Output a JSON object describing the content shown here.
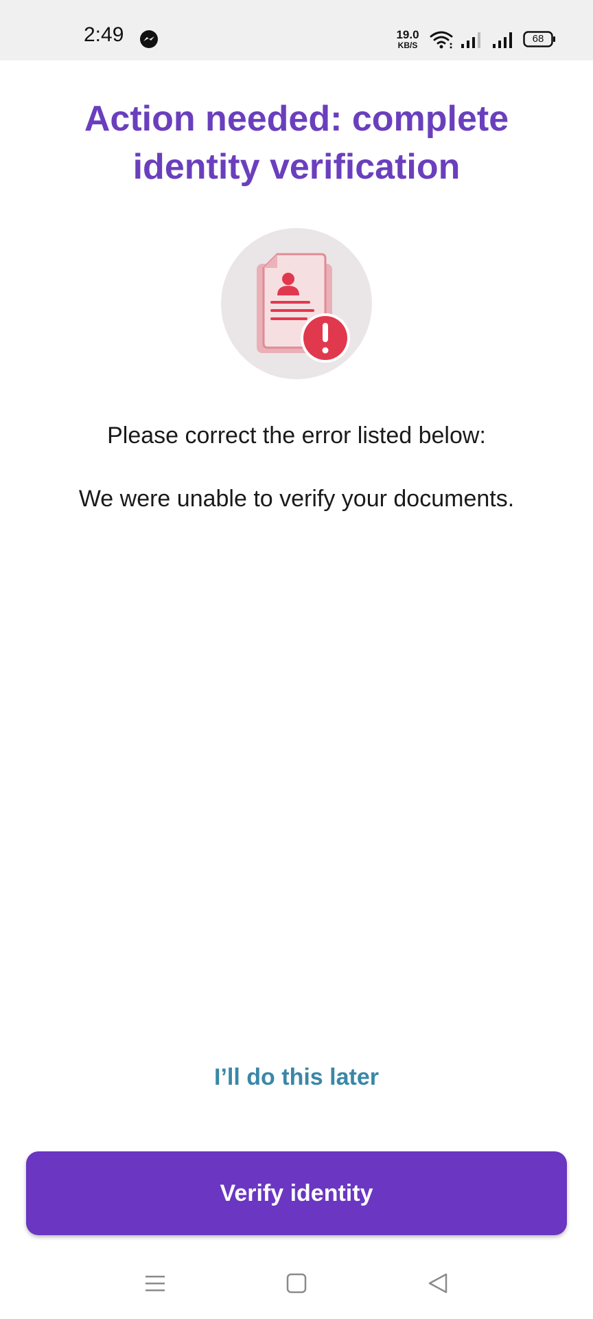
{
  "status_bar": {
    "time": "2:49",
    "net_speed_value": "19.0",
    "net_speed_unit": "KB/S",
    "battery_level": "68",
    "icons": [
      "messenger-icon",
      "wifi-icon",
      "signal-icon",
      "signal-icon",
      "battery-icon"
    ]
  },
  "main": {
    "title": "Action needed: complete identity verification",
    "illustration_icon": "document-error-icon",
    "instruction": "Please correct the error listed below:",
    "error_message": "We were unable to verify your documents.",
    "later_link": "I’ll do this later",
    "verify_button": "Verify identity"
  },
  "nav_bar": {
    "icons": [
      "menu-icon",
      "home-icon",
      "back-icon"
    ]
  },
  "colors": {
    "title": "#6a3fbd",
    "primary_button": "#6a36c2",
    "link": "#3a87a8",
    "status_bar_bg": "#f0f0f0",
    "error_red": "#e0394e"
  }
}
